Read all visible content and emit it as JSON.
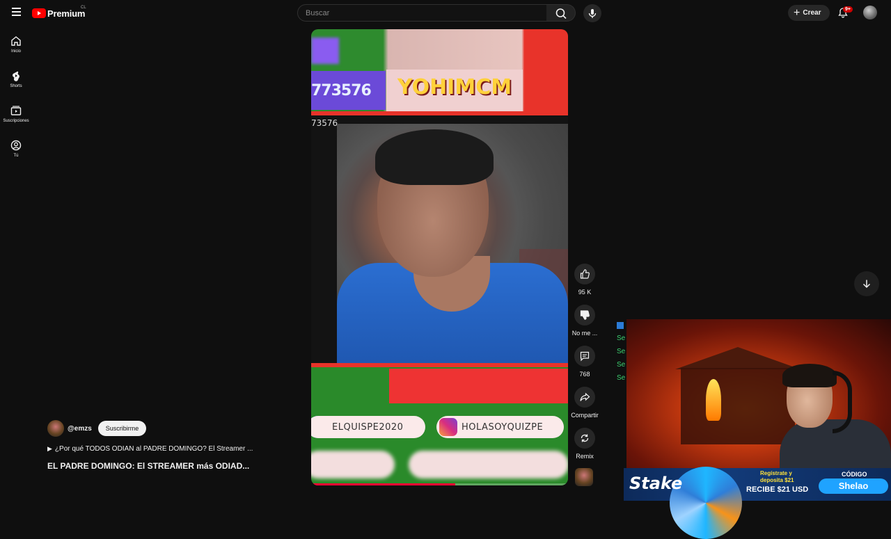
{
  "header": {
    "logo_text": "Premium",
    "region": "CL",
    "search_placeholder": "Buscar",
    "create_label": "Crear",
    "notification_count": "9+"
  },
  "sidebar": {
    "items": [
      {
        "label": "Inicio",
        "icon": "home-icon"
      },
      {
        "label": "Shorts",
        "icon": "shorts-icon"
      },
      {
        "label": "Suscripciones",
        "icon": "subscriptions-icon"
      },
      {
        "label": "Tú",
        "icon": "you-icon"
      }
    ]
  },
  "video": {
    "overlay_number": "773576",
    "overlay_number_small": "73576",
    "overlay_brand": "YOHIMCM",
    "social_facebook": "ELQUISPE2020",
    "social_instagram": "HOLASOYQUIZPE",
    "progress_fraction": 0.56
  },
  "actions": {
    "like_count": "95 K",
    "dislike_label": "No me ...",
    "comment_count": "768",
    "share_label": "Compartir",
    "remix_label": "Remix"
  },
  "meta": {
    "channel": "@emzs",
    "subscribe_label": "Suscribirme",
    "playlist_text": "¿Por qué TODOS ODIAN al PADRE DOMINGO? El Streamer ...",
    "title": "EL PADRE DOMINGO: El STREAMER más ODIAD..."
  },
  "stream_overlay": {
    "chat_lines": [
      "Se",
      "Se",
      "Se",
      "Se"
    ],
    "stake_logo": "Stake",
    "promo_line1": "Regístrate y",
    "promo_line2": "deposita $21",
    "promo_line3": "RECIBE $21 USD",
    "code_label": "CÓDIGO",
    "code_value": "Shelao"
  },
  "colors": {
    "background": "#0f0f0f",
    "accent_red": "#ff0033",
    "chat_green": "#3cd070",
    "stake_blue": "#1fa3ff"
  }
}
